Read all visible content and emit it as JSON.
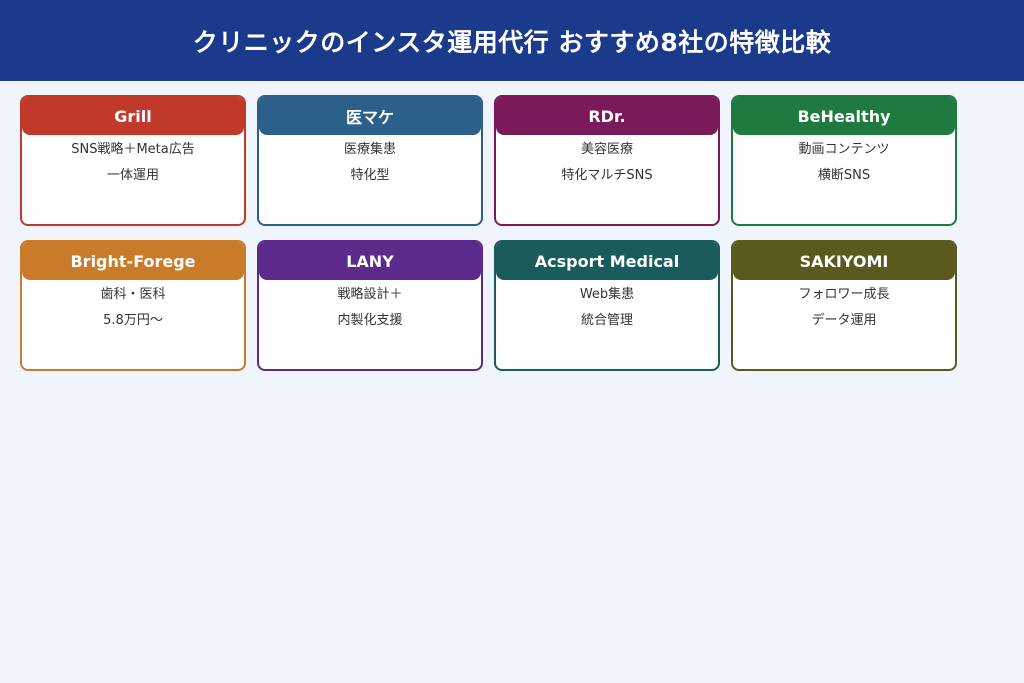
{
  "header": {
    "title": "クリニックのインスタ運用代行 おすすめ8社の特徴比較"
  },
  "cards": [
    {
      "name": "Grill",
      "lines": [
        "SNS戦略＋Meta広告",
        "一体運用"
      ],
      "color": "#c0392b"
    },
    {
      "name": "医マケ",
      "lines": [
        "医療集患",
        "特化型"
      ],
      "color": "#2c5f8a"
    },
    {
      "name": "RDr.",
      "lines": [
        "美容医療",
        "特化マルチSNS"
      ],
      "color": "#7a1a5a"
    },
    {
      "name": "BeHealthy",
      "lines": [
        "動画コンテンツ",
        "横断SNS"
      ],
      "color": "#1e7a3e"
    },
    {
      "name": "Bright-Forege",
      "lines": [
        "歯科・医科",
        "5.8万円〜"
      ],
      "color": "#c97b2a"
    },
    {
      "name": "LANY",
      "lines": [
        "戦略設計＋",
        "内製化支援"
      ],
      "color": "#5b2a8a"
    },
    {
      "name": "Acsport Medical",
      "lines": [
        "Web集患",
        "統合管理"
      ],
      "color": "#1a5c5c"
    },
    {
      "name": "SAKIYOMI",
      "lines": [
        "フォロワー成長",
        "データ運用"
      ],
      "color": "#5a5a1e"
    }
  ]
}
